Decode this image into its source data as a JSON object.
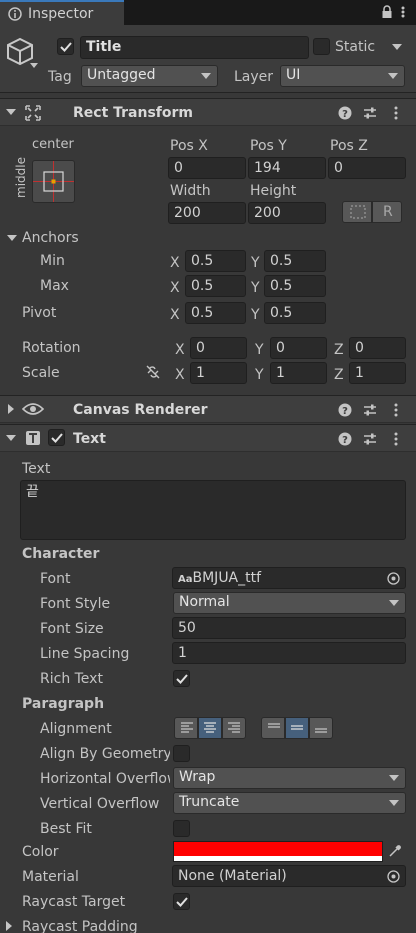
{
  "tab": {
    "title": "Inspector"
  },
  "object": {
    "name": "Title",
    "static_label": "Static",
    "tag_label": "Tag",
    "tag_value": "Untagged",
    "layer_label": "Layer",
    "layer_value": "UI"
  },
  "rect_transform": {
    "title": "Rect Transform",
    "anchor_preset_h": "center",
    "anchor_preset_v": "middle",
    "pos_x_label": "Pos X",
    "pos_y_label": "Pos Y",
    "pos_z_label": "Pos Z",
    "pos_x": "0",
    "pos_y": "194",
    "pos_z": "0",
    "width_label": "Width",
    "height_label": "Height",
    "width": "200",
    "height": "200",
    "raw_edit_label": "R",
    "anchors_label": "Anchors",
    "min_label": "Min",
    "max_label": "Max",
    "pivot_label": "Pivot",
    "x_axis": "X",
    "y_axis": "Y",
    "z_axis": "Z",
    "min_x": "0.5",
    "min_y": "0.5",
    "max_x": "0.5",
    "max_y": "0.5",
    "pivot_x": "0.5",
    "pivot_y": "0.5",
    "rotation_label": "Rotation",
    "scale_label": "Scale",
    "rot_x": "0",
    "rot_y": "0",
    "rot_z": "0",
    "scale_x": "1",
    "scale_y": "1",
    "scale_z": "1"
  },
  "canvas_renderer": {
    "title": "Canvas Renderer"
  },
  "text_component": {
    "title": "Text",
    "text_label": "Text",
    "text_value": "끝",
    "character_label": "Character",
    "font_label": "Font",
    "font_value": "BMJUA_ttf",
    "font_icon_text": "Aa",
    "font_style_label": "Font Style",
    "font_style_value": "Normal",
    "font_size_label": "Font Size",
    "font_size_value": "50",
    "line_spacing_label": "Line Spacing",
    "line_spacing_value": "1",
    "rich_text_label": "Rich Text",
    "paragraph_label": "Paragraph",
    "alignment_label": "Alignment",
    "align_by_geometry_label": "Align By Geometry",
    "horizontal_overflow_label": "Horizontal Overflow",
    "horizontal_overflow_value": "Wrap",
    "vertical_overflow_label": "Vertical Overflow",
    "vertical_overflow_value": "Truncate",
    "best_fit_label": "Best Fit",
    "color_label": "Color",
    "color_value": "#ff0000",
    "material_label": "Material",
    "material_value": "None (Material)",
    "raycast_target_label": "Raycast Target",
    "raycast_padding_label": "Raycast Padding"
  }
}
